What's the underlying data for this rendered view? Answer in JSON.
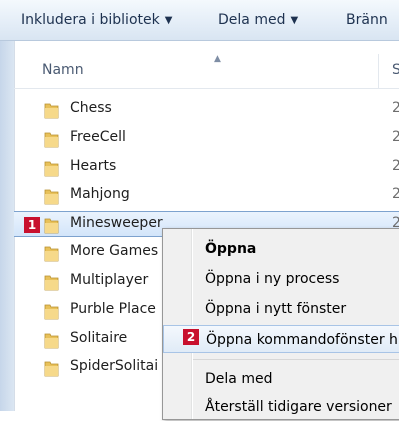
{
  "toolbar": {
    "include_library": "Inkludera i bibliotek",
    "share_with": "Dela med",
    "burn": "Bränn"
  },
  "header": {
    "name_column": "Namn",
    "next_column": "S"
  },
  "rows": [
    {
      "label": "Chess",
      "date": "2"
    },
    {
      "label": "FreeCell",
      "date": "2"
    },
    {
      "label": "Hearts",
      "date": "2"
    },
    {
      "label": "Mahjong",
      "date": "2"
    },
    {
      "label": "Minesweeper",
      "date": "2"
    },
    {
      "label": "More Games",
      "date": "2"
    },
    {
      "label": "Multiplayer",
      "date": "2"
    },
    {
      "label": "Purble Place",
      "date": "2"
    },
    {
      "label": "Solitaire",
      "date": "2"
    },
    {
      "label": "SpiderSolitai",
      "date": "2"
    }
  ],
  "callouts": {
    "one": "1",
    "two": "2"
  },
  "menu": {
    "open": "Öppna",
    "open_new_process": "Öppna i ny process",
    "open_new_window": "Öppna i nytt fönster",
    "open_command_window": "Öppna kommandofönster h",
    "share_with": "Dela med",
    "restore_versions": "Återställ tidigare versioner"
  },
  "colors": {
    "callout": "#c8102e",
    "folder": "#e8c15a",
    "selection": "#d3e5fa"
  },
  "icons": {
    "folder": "folder-icon",
    "dropdown": "chevron-down-icon"
  }
}
